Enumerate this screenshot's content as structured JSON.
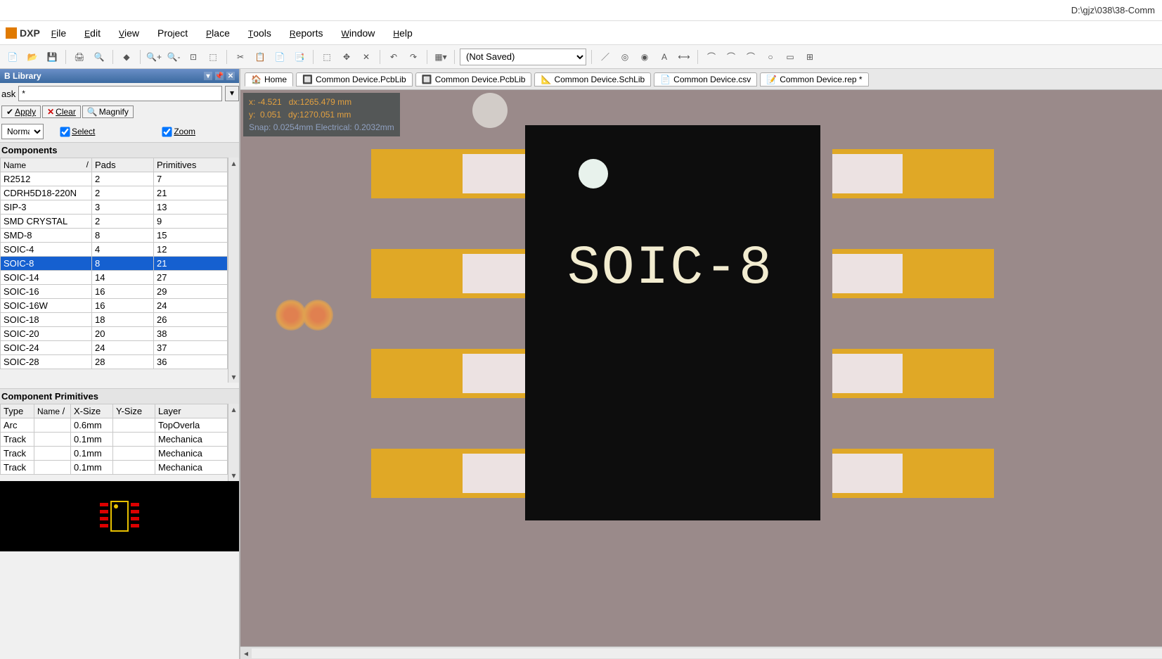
{
  "title_path": "D:\\gjz\\038\\38-Comm",
  "menu": {
    "logo": "DXP",
    "items": [
      "File",
      "Edit",
      "View",
      "Project",
      "Place",
      "Tools",
      "Reports",
      "Window",
      "Help"
    ]
  },
  "toolbar_combo": "(Not Saved)",
  "panel_title": "B Library",
  "mask_label": "ask",
  "mask_value": "*",
  "btn_apply": "Apply",
  "btn_clear": "Clear",
  "btn_magnify": "Magnify",
  "combo_mode": "Normal",
  "chk_select": "Select",
  "chk_zoom": "Zoom",
  "section_components": "Components",
  "comp_headers": [
    "Name",
    "Pads",
    "Primitives"
  ],
  "comp_rows": [
    {
      "name": "R2512",
      "pads": "2",
      "prims": "7",
      "sel": false
    },
    {
      "name": "CDRH5D18-220N",
      "pads": "2",
      "prims": "21",
      "sel": false
    },
    {
      "name": "SIP-3",
      "pads": "3",
      "prims": "13",
      "sel": false
    },
    {
      "name": "SMD CRYSTAL",
      "pads": "2",
      "prims": "9",
      "sel": false
    },
    {
      "name": "SMD-8",
      "pads": "8",
      "prims": "15",
      "sel": false
    },
    {
      "name": "SOIC-4",
      "pads": "4",
      "prims": "12",
      "sel": false
    },
    {
      "name": "SOIC-8",
      "pads": "8",
      "prims": "21",
      "sel": true
    },
    {
      "name": "SOIC-14",
      "pads": "14",
      "prims": "27",
      "sel": false
    },
    {
      "name": "SOIC-16",
      "pads": "16",
      "prims": "29",
      "sel": false
    },
    {
      "name": "SOIC-16W",
      "pads": "16",
      "prims": "24",
      "sel": false
    },
    {
      "name": "SOIC-18",
      "pads": "18",
      "prims": "26",
      "sel": false
    },
    {
      "name": "SOIC-20",
      "pads": "20",
      "prims": "38",
      "sel": false
    },
    {
      "name": "SOIC-24",
      "pads": "24",
      "prims": "37",
      "sel": false
    },
    {
      "name": "SOIC-28",
      "pads": "28",
      "prims": "36",
      "sel": false
    }
  ],
  "section_primitives": "Component Primitives",
  "prim_headers": [
    "Type",
    "Name",
    "X-Size",
    "Y-Size",
    "Layer"
  ],
  "prim_rows": [
    {
      "type": "Arc",
      "name": "",
      "x": "0.6mm",
      "y": "",
      "layer": "TopOverla"
    },
    {
      "type": "Track",
      "name": "",
      "x": "0.1mm",
      "y": "",
      "layer": "Mechanica"
    },
    {
      "type": "Track",
      "name": "",
      "x": "0.1mm",
      "y": "",
      "layer": "Mechanica"
    },
    {
      "type": "Track",
      "name": "",
      "x": "0.1mm",
      "y": "",
      "layer": "Mechanica"
    }
  ],
  "tabs": [
    {
      "label": "Home",
      "icon": "home",
      "active": true
    },
    {
      "label": "Common Device.PcbLib",
      "icon": "pcb",
      "active": false
    },
    {
      "label": "Common Device.PcbLib",
      "icon": "pcb",
      "active": false
    },
    {
      "label": "Common Device.SchLib",
      "icon": "sch",
      "active": false
    },
    {
      "label": "Common Device.csv",
      "icon": "csv",
      "active": false
    },
    {
      "label": "Common Device.rep *",
      "icon": "txt",
      "active": false
    }
  ],
  "coord": {
    "line1": "x: -4.521   dx:1265.479 mm",
    "line2": "y:  0.051   dy:1270.051 mm",
    "line3": "Snap: 0.0254mm Electrical: 0.2032mm"
  },
  "chip_label": "SOIC-8"
}
